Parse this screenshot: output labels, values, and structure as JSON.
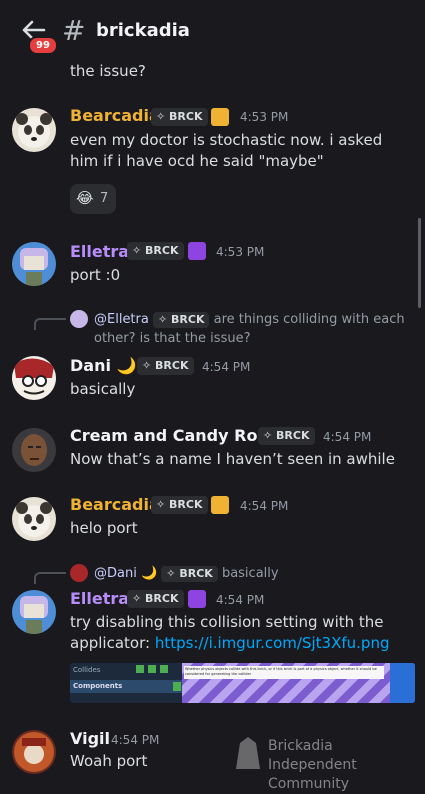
{
  "header": {
    "badge": "99",
    "hash": "#",
    "channel": "brickadia"
  },
  "prev_text": "the issue?",
  "tag_label": "BRCK",
  "messages": [
    {
      "author": "Bearcadia",
      "color": "#f0b232",
      "time": "4:53 PM",
      "text": "even my doctor is stochastic now. i asked him if i have ocd he said \"maybe\"",
      "reaction_emoji": "😂",
      "reaction_count": "7"
    },
    {
      "author": "Elletra",
      "color": "#b78dfa",
      "time": "4:53 PM",
      "text": "port :0"
    },
    {
      "reply_author": "@Elletra",
      "reply_text": "are things colliding with each other? is that the issue?",
      "author": "Dani",
      "author_emoji": "🌙",
      "color": "#f2f3f5",
      "time": "4:54 PM",
      "text": "basically"
    },
    {
      "author": "Cream and Candy Rocks",
      "color": "#f2f3f5",
      "time": "4:54 PM",
      "text": "Now that’s a name I haven’t seen in awhile"
    },
    {
      "author": "Bearcadia",
      "color": "#f0b232",
      "time": "4:54 PM",
      "text": "helo port"
    },
    {
      "reply_author": "@Dani",
      "reply_emoji": "🌙",
      "reply_text": "basically",
      "author": "Elletra",
      "color": "#b78dfa",
      "time": "4:54 PM",
      "text_before": "try disabling this collision setting with the applicator:",
      "link": "https://i.imgur.com/Sjt3Xfu.png"
    },
    {
      "author": "Vigil",
      "color": "#f2f3f5",
      "time": "4:54 PM",
      "text": "Woah port"
    }
  ],
  "embed": {
    "collides": "Collides",
    "components": "Components",
    "tooltip": "Whether physics objects collide with this brick, or if this brick is part of a physics object, whether it should be considered for generating the collider"
  },
  "watermark": {
    "line1": "Brickadia Independent",
    "line2": "Community"
  }
}
